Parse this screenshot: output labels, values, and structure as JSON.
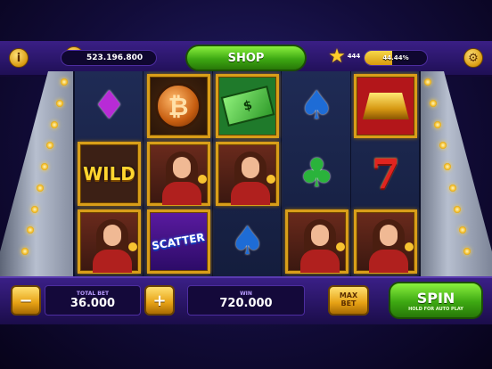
{
  "header": {
    "info_glyph": "i",
    "coin_symbol": "R",
    "coin_balance": "523.196.800",
    "shop_label": "SHOP",
    "level": "444",
    "xp_percent_text": "44.44%",
    "xp_fraction": 0.4444,
    "settings_icon": "gear-icon",
    "info_icon": "info-icon"
  },
  "reels": [
    [
      "diamond",
      "wild",
      "woman"
    ],
    [
      "bitcoin",
      "woman",
      "scatter"
    ],
    [
      "cash",
      "woman",
      "spade"
    ],
    [
      "spade",
      "club",
      "woman"
    ],
    [
      "gold",
      "seven",
      "woman"
    ]
  ],
  "symbols": {
    "wild_text": "WILD",
    "scatter_text": "SCATTER",
    "bitcoin_glyph": "₿",
    "cash_glyph": "$",
    "seven_glyph": "7",
    "spade_glyph": "♠",
    "club_glyph": "♣",
    "diamond_glyph": "♦"
  },
  "footer": {
    "minus_glyph": "−",
    "plus_glyph": "+",
    "total_bet_label": "TOTAL BET",
    "total_bet_value": "36.000",
    "win_label": "WIN",
    "win_value": "720.000",
    "max_label_1": "MAX",
    "max_label_2": "BET",
    "spin_label": "SPIN",
    "spin_sub": "HOLD FOR AUTO PLAY"
  },
  "colors": {
    "accent_gold": "#e6a114",
    "accent_green": "#3da812",
    "panel_purple": "#3a1f86"
  }
}
